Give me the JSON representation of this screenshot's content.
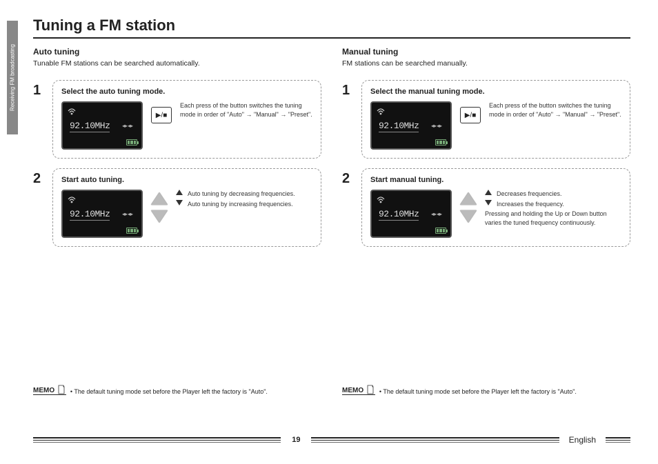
{
  "side_tab": "Receiving FM broadcasting",
  "title": "Tuning a FM station",
  "left": {
    "heading": "Auto tuning",
    "desc": "Tunable FM stations can be searched automatically.",
    "step1": {
      "num": "1",
      "title": "Select the auto tuning mode.",
      "freq": "92.10MHz",
      "play_label": "▶/■",
      "note": "Each press of the button switches the tuning mode in order of \"Auto\" → \"Manual\" → \"Preset\"."
    },
    "step2": {
      "num": "2",
      "title": "Start auto tuning.",
      "freq": "92.10MHz",
      "note_up": "Auto tuning by decreasing frequencies.",
      "note_down": "Auto tuning by increasing frequencies."
    },
    "memo_label": "MEMO",
    "memo_text": "• The default tuning mode set before the Player left the factory is \"Auto\"."
  },
  "right": {
    "heading": "Manual tuning",
    "desc": "FM stations can be searched manually.",
    "step1": {
      "num": "1",
      "title": "Select the manual tuning mode.",
      "freq": "92.10MHz",
      "play_label": "▶/■",
      "note": "Each press of the button switches the tuning mode in order of \"Auto\" → \"Manual\" → \"Preset\"."
    },
    "step2": {
      "num": "2",
      "title": "Start manual tuning.",
      "freq": "92.10MHz",
      "note_up": "Decreases frequencies.",
      "note_down": "Increases the frequency.",
      "note_extra": "Pressing and holding the Up or Down button varies the tuned frequency continuously."
    },
    "memo_label": "MEMO",
    "memo_text": "• The default tuning mode set before the Player left the factory is \"Auto\"."
  },
  "footer": {
    "page": "19",
    "lang": "English"
  }
}
